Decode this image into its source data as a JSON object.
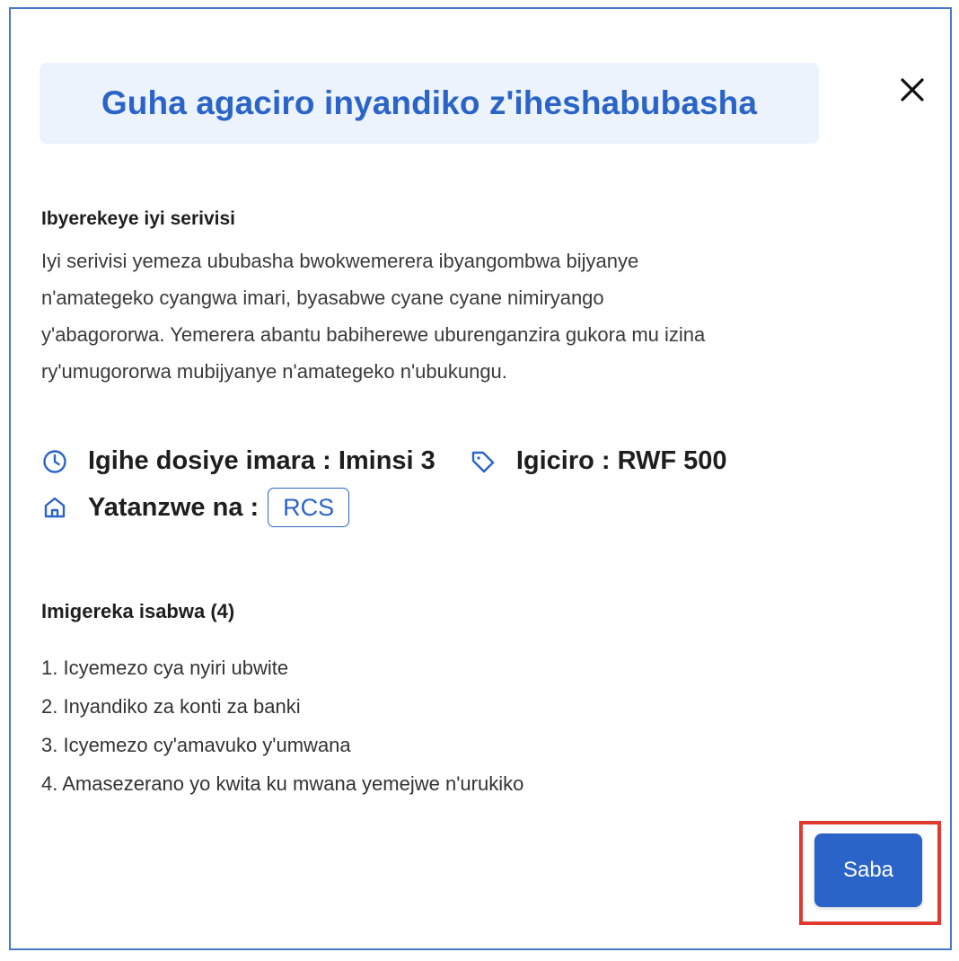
{
  "dialog": {
    "title": "Guha agaciro inyandiko z'iheshabubasha",
    "close_icon": "close-icon"
  },
  "about": {
    "heading": "Ibyerekeye iyi serivisi",
    "lines": [
      "Iyi serivisi yemeza ububasha bwokwemerera ibyangombwa bijyanye",
      "n'amategeko cyangwa imari, byasabwe cyane cyane nimiryango",
      "y'abagororwa. Yemerera abantu babiherewe uburenganzira gukora mu izina",
      "ry'umugororwa mubijyanye n'amategeko n'ubukungu."
    ]
  },
  "meta": {
    "processing_time": "Igihe dosiye imara : Iminsi 3",
    "price": "Igiciro : RWF 500",
    "provider_label": "Yatanzwe na :",
    "provider": "RCS",
    "icons": {
      "time": "clock-icon",
      "price": "tag-icon",
      "provider": "home-icon"
    }
  },
  "requirements": {
    "heading": "Imigereka isabwa (4)",
    "items": [
      "1. Icyemezo cya nyiri ubwite",
      "2. Inyandiko za konti za banki",
      "3. Icyemezo cy'amavuko y'umwana",
      "4. Amasezerano yo kwita ku mwana yemejwe n'urukiko"
    ]
  },
  "actions": {
    "apply_label": "Saba"
  },
  "colors": {
    "accent": "#2b64c8",
    "title_bg": "#ecf3fd",
    "modal_border": "#4a78c8",
    "highlight": "#e03a2f"
  }
}
